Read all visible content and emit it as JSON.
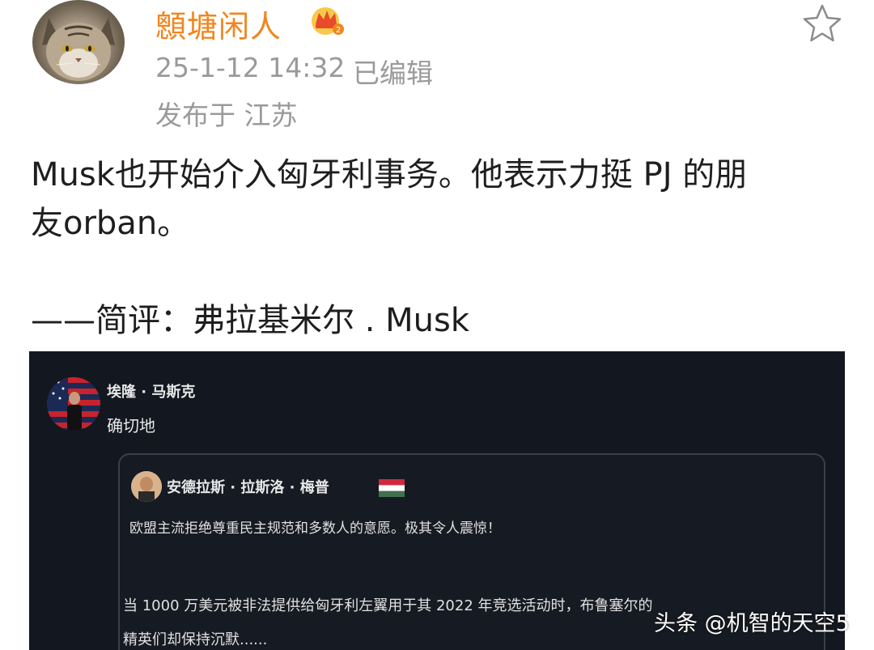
{
  "author": {
    "name": "顖塘闲人",
    "avatar_icon": "cat-avatar",
    "badge_icon": "crown-badge-icon"
  },
  "post_meta": {
    "timestamp": "25-1-12 14:32",
    "edited": "已编辑",
    "location": "发布于 江苏"
  },
  "post": {
    "line1": "Musk也开始介入匈牙利事务。他表示力挺 PJ 的朋",
    "line2": "友orban。",
    "comment": "——简评：弗拉基米尔 . Musk"
  },
  "embed": {
    "author_name": "埃隆 · 马斯克",
    "reply_text": "确切地",
    "quote": {
      "author_name": "安德拉斯 · 拉斯洛 · 梅普",
      "flag_icon": "hungary-flag-icon",
      "line1": "欧盟主流拒绝尊重民主规范和多数人的意愿。极其令人震惊！",
      "line2": "当 1000 万美元被非法提供给匈牙利左翼用于其 2022 年竞选活动时，布鲁塞尔的",
      "line3": "精英们却保持沉默......"
    }
  },
  "watermark": "头条 @机智的天空5",
  "colors": {
    "username": "#f0861f",
    "meta": "#9a9a9a",
    "embed_bg": "#13171f"
  }
}
